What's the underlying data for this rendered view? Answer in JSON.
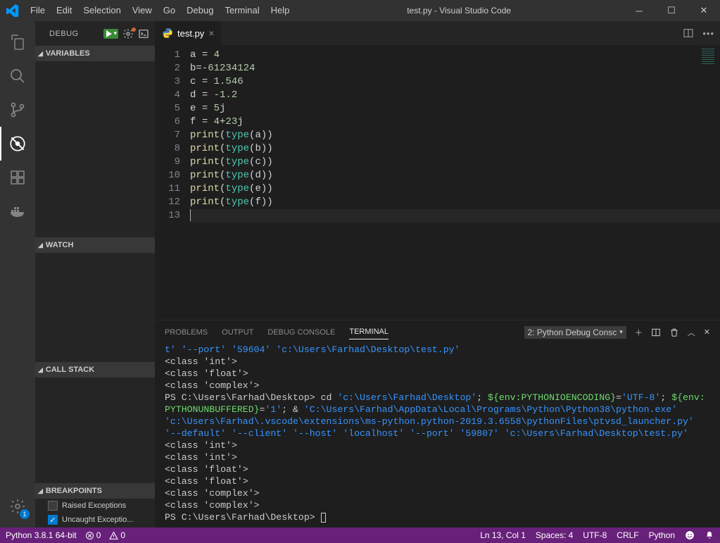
{
  "title": "test.py - Visual Studio Code",
  "menu": [
    "File",
    "Edit",
    "Selection",
    "View",
    "Go",
    "Debug",
    "Terminal",
    "Help"
  ],
  "activity_badge": "1",
  "debug": {
    "title": "DEBUG",
    "sections": {
      "variables": "VARIABLES",
      "watch": "WATCH",
      "callstack": "CALL STACK",
      "breakpoints": "BREAKPOINTS"
    },
    "breakpoints": {
      "raised": {
        "label": "Raised Exceptions",
        "checked": false
      },
      "uncaught": {
        "label": "Uncaught Exceptio...",
        "checked": true
      }
    }
  },
  "tab": {
    "file": "test.py"
  },
  "code": {
    "lines": [
      {
        "n": "1",
        "tokens": [
          [
            "id",
            "a "
          ],
          [
            "op",
            "= "
          ],
          [
            "num",
            "4"
          ]
        ]
      },
      {
        "n": "2",
        "tokens": [
          [
            "id",
            "b"
          ],
          [
            "op",
            "="
          ],
          [
            "num",
            "-61234124"
          ]
        ]
      },
      {
        "n": "3",
        "tokens": [
          [
            "id",
            "c "
          ],
          [
            "op",
            "= "
          ],
          [
            "num",
            "1.546"
          ]
        ]
      },
      {
        "n": "4",
        "tokens": [
          [
            "id",
            "d "
          ],
          [
            "op",
            "= "
          ],
          [
            "num",
            "-1.2"
          ]
        ]
      },
      {
        "n": "5",
        "tokens": [
          [
            "id",
            "e "
          ],
          [
            "op",
            "= "
          ],
          [
            "num",
            "5"
          ],
          [
            "id",
            "j"
          ]
        ]
      },
      {
        "n": "6",
        "tokens": [
          [
            "id",
            "f "
          ],
          [
            "op",
            "= "
          ],
          [
            "num",
            "4"
          ],
          [
            "op",
            "+"
          ],
          [
            "num",
            "23"
          ],
          [
            "id",
            "j"
          ]
        ]
      },
      {
        "n": "7",
        "tokens": [
          [
            "fn",
            "print"
          ],
          [
            "par",
            "("
          ],
          [
            "builtin",
            "type"
          ],
          [
            "par",
            "("
          ],
          [
            "id",
            "a"
          ],
          [
            "par",
            "))"
          ]
        ]
      },
      {
        "n": "8",
        "tokens": [
          [
            "fn",
            "print"
          ],
          [
            "par",
            "("
          ],
          [
            "builtin",
            "type"
          ],
          [
            "par",
            "("
          ],
          [
            "id",
            "b"
          ],
          [
            "par",
            "))"
          ]
        ]
      },
      {
        "n": "9",
        "tokens": [
          [
            "fn",
            "print"
          ],
          [
            "par",
            "("
          ],
          [
            "builtin",
            "type"
          ],
          [
            "par",
            "("
          ],
          [
            "id",
            "c"
          ],
          [
            "par",
            "))"
          ]
        ]
      },
      {
        "n": "10",
        "tokens": [
          [
            "fn",
            "print"
          ],
          [
            "par",
            "("
          ],
          [
            "builtin",
            "type"
          ],
          [
            "par",
            "("
          ],
          [
            "id",
            "d"
          ],
          [
            "par",
            "))"
          ]
        ]
      },
      {
        "n": "11",
        "tokens": [
          [
            "fn",
            "print"
          ],
          [
            "par",
            "("
          ],
          [
            "builtin",
            "type"
          ],
          [
            "par",
            "("
          ],
          [
            "id",
            "e"
          ],
          [
            "par",
            "))"
          ]
        ]
      },
      {
        "n": "12",
        "tokens": [
          [
            "fn",
            "print"
          ],
          [
            "par",
            "("
          ],
          [
            "builtin",
            "type"
          ],
          [
            "par",
            "("
          ],
          [
            "id",
            "f"
          ],
          [
            "par",
            "))"
          ]
        ]
      },
      {
        "n": "13",
        "tokens": [],
        "current": true
      }
    ]
  },
  "panel": {
    "tabs": {
      "problems": "PROBLEMS",
      "output": "OUTPUT",
      "debugconsole": "DEBUG CONSOLE",
      "terminal": "TERMINAL"
    },
    "select": "2: Python Debug Consc",
    "terminal_segments": [
      [
        "cyan",
        "t' '--port' '59604' 'c:\\Users\\Farhad\\Desktop\\test.py'"
      ],
      [
        "br"
      ],
      [
        "white",
        "<class 'int'>"
      ],
      [
        "br"
      ],
      [
        "white",
        "<class 'float'>"
      ],
      [
        "br"
      ],
      [
        "white",
        "<class 'complex'>"
      ],
      [
        "br"
      ],
      [
        "prompt",
        "PS C:\\Users\\Farhad\\Desktop> "
      ],
      [
        "yellow",
        "cd "
      ],
      [
        "cyan",
        "'c:\\Users\\Farhad\\Desktop'"
      ],
      [
        "white",
        "; "
      ],
      [
        "env",
        "${env:PYTHONIOENCODING}"
      ],
      [
        "white",
        "="
      ],
      [
        "cyan",
        "'UTF-8'"
      ],
      [
        "white",
        "; "
      ],
      [
        "env",
        "${env:PYTHONUNBUFFERED}"
      ],
      [
        "white",
        "="
      ],
      [
        "cyan",
        "'1'"
      ],
      [
        "white",
        "; & "
      ],
      [
        "cyan",
        "'C:\\Users\\Farhad\\AppData\\Local\\Programs\\Python\\Python38\\python.exe' 'c:\\Users\\Farhad\\.vscode\\extensions\\ms-python.python-2019.3.6558\\pythonFiles\\ptvsd_launcher.py' '--default' '--client' '--host' 'localhost' '--port' '59807' 'c:\\Users\\Farhad\\Desktop\\test.py'"
      ],
      [
        "br"
      ],
      [
        "white",
        "<class 'int'>"
      ],
      [
        "br"
      ],
      [
        "white",
        "<class 'int'>"
      ],
      [
        "br"
      ],
      [
        "white",
        "<class 'float'>"
      ],
      [
        "br"
      ],
      [
        "white",
        "<class 'float'>"
      ],
      [
        "br"
      ],
      [
        "white",
        "<class 'complex'>"
      ],
      [
        "br"
      ],
      [
        "white",
        "<class 'complex'>"
      ],
      [
        "br"
      ],
      [
        "prompt",
        "PS C:\\Users\\Farhad\\Desktop> "
      ],
      [
        "cursorbox",
        ""
      ]
    ]
  },
  "status": {
    "python": "Python 3.8.1 64-bit",
    "errors": "0",
    "warnings": "0",
    "lncol": "Ln 13, Col 1",
    "spaces": "Spaces: 4",
    "encoding": "UTF-8",
    "eol": "CRLF",
    "lang": "Python"
  }
}
